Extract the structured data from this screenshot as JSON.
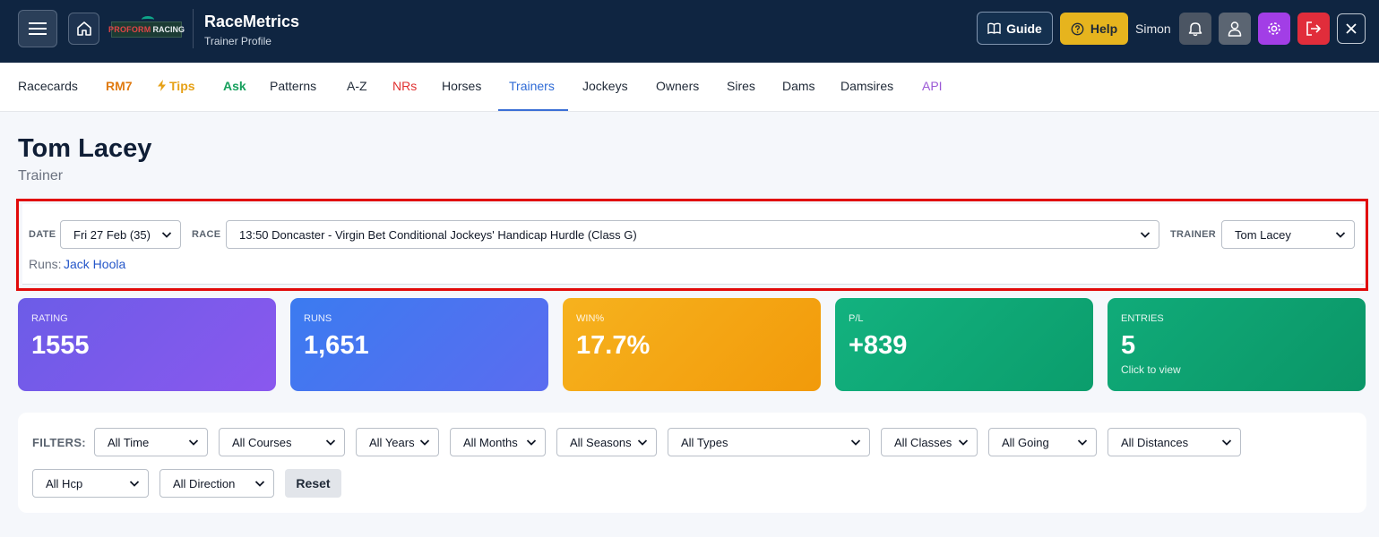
{
  "header": {
    "app_title": "RaceMetrics",
    "app_subtitle": "Trainer Profile",
    "logo_text_a": "PROFORM",
    "logo_text_b": "RACING",
    "guide_label": "Guide",
    "help_label": "Help",
    "user_name": "Simon"
  },
  "nav": {
    "items": [
      {
        "label": "Racecards",
        "color": "#1f2937"
      },
      {
        "label": "RM7",
        "color": "#e07b12"
      },
      {
        "label": "Tips",
        "color": "#e6a117"
      },
      {
        "label": "Ask",
        "color": "#17a05d"
      },
      {
        "label": "Patterns",
        "color": "#1f2937"
      },
      {
        "label": "A-Z",
        "color": "#1f2937"
      },
      {
        "label": "NRs",
        "color": "#e03131"
      },
      {
        "label": "Horses",
        "color": "#1f2937"
      },
      {
        "label": "Trainers",
        "color": "#2f6bd6"
      },
      {
        "label": "Jockeys",
        "color": "#1f2937"
      },
      {
        "label": "Owners",
        "color": "#1f2937"
      },
      {
        "label": "Sires",
        "color": "#1f2937"
      },
      {
        "label": "Dams",
        "color": "#1f2937"
      },
      {
        "label": "Damsires",
        "color": "#1f2937"
      },
      {
        "label": "API",
        "color": "#9b59d6"
      }
    ],
    "active": "Trainers"
  },
  "page": {
    "title": "Tom Lacey",
    "subtitle": "Trainer"
  },
  "selector": {
    "date_label": "DATE",
    "date_value": "Fri 27 Feb (35)",
    "race_label": "RACE",
    "race_value": "13:50 Doncaster - Virgin Bet Conditional Jockeys' Handicap Hurdle (Class G)",
    "trainer_label": "TRAINER",
    "trainer_value": "Tom Lacey",
    "runs_label": "Runs:",
    "runs_horse": "Jack Hoola"
  },
  "stats": [
    {
      "label": "RATING",
      "value": "1555"
    },
    {
      "label": "RUNS",
      "value": "1,651"
    },
    {
      "label": "WIN%",
      "value": "17.7%"
    },
    {
      "label": "P/L",
      "value": "+839"
    },
    {
      "label": "ENTRIES",
      "value": "5",
      "hint": "Click to view"
    }
  ],
  "filters": {
    "label": "FILTERS:",
    "selects": [
      "All Time",
      "All Courses",
      "All Years",
      "All Months",
      "All Seasons",
      "All Types",
      "All Classes",
      "All Going",
      "All Distances",
      "All Hcp",
      "All Direction"
    ],
    "reset_label": "Reset"
  }
}
